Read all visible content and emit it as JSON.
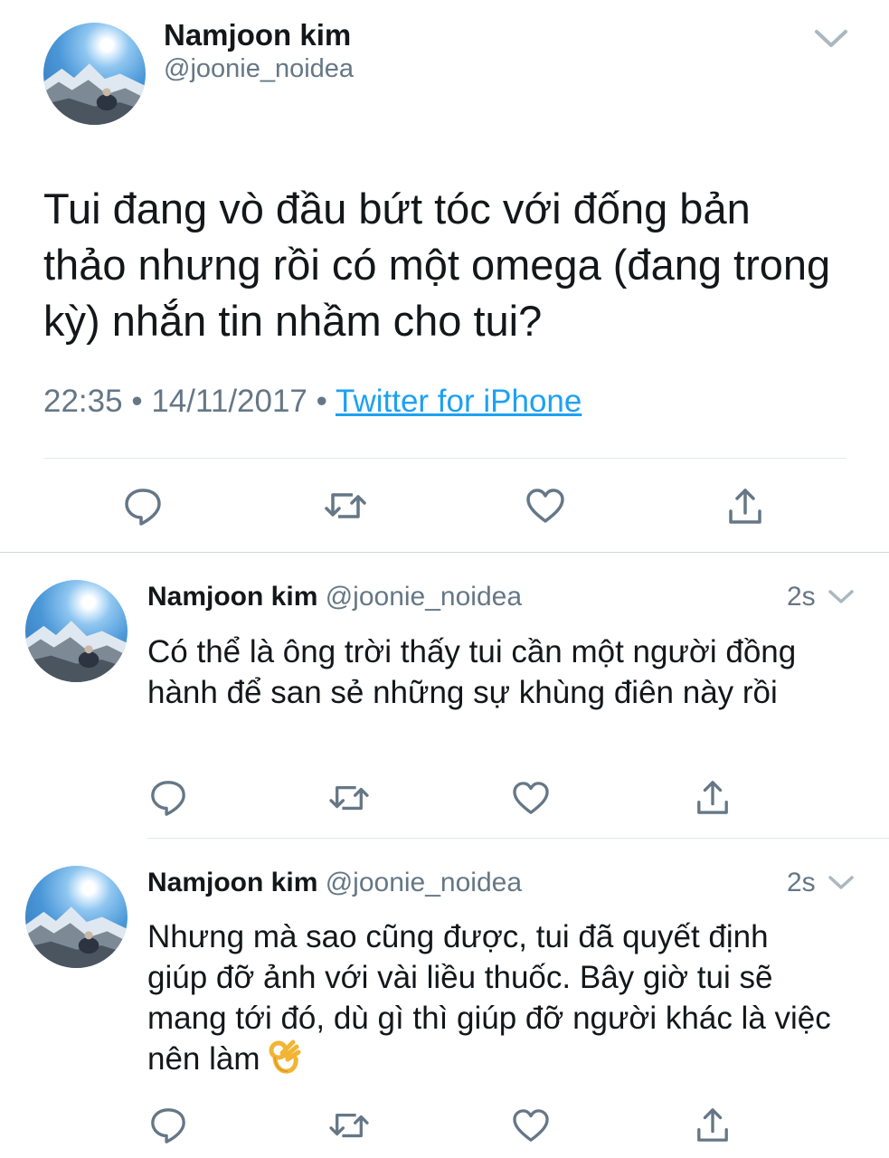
{
  "main_tweet": {
    "name": "Namjoon kim",
    "handle": "@joonie_noidea",
    "text": "Tui đang vò đầu bứt tóc với đống bản thảo nhưng rồi có một omega (đang trong kỳ) nhắn tin nhầm cho tui?",
    "time": "22:35",
    "date": "14/11/2017",
    "separator": "•",
    "source": "Twitter for iPhone",
    "avatar_icon": "profile-photo-mountain-sky"
  },
  "replies": [
    {
      "name": "Namjoon kim",
      "handle": "@joonie_noidea",
      "time": "2s",
      "text": "Có thể là ông trời thấy tui cần một người đồng hành để san sẻ những sự khùng điên này rồi"
    },
    {
      "name": "Namjoon kim",
      "handle": "@joonie_noidea",
      "time": "2s",
      "text": "Nhưng mà sao cũng được, tui đã quyết định giúp đỡ ảnh với vài liều thuốc. Bây giờ tui sẽ mang tới đó, dù gì thì giúp đỡ người khác là việc nên làm",
      "emoji": "ok-hand-emoji"
    }
  ],
  "icons": {
    "reply": "speech-bubble-icon",
    "retweet": "retweet-arrows-icon",
    "like": "heart-icon",
    "share": "share-upload-icon",
    "menu": "chevron-down-icon"
  },
  "colors": {
    "text": "#14171a",
    "secondary": "#657786",
    "link": "#1da1f2",
    "divider": "#e1e8ed"
  }
}
